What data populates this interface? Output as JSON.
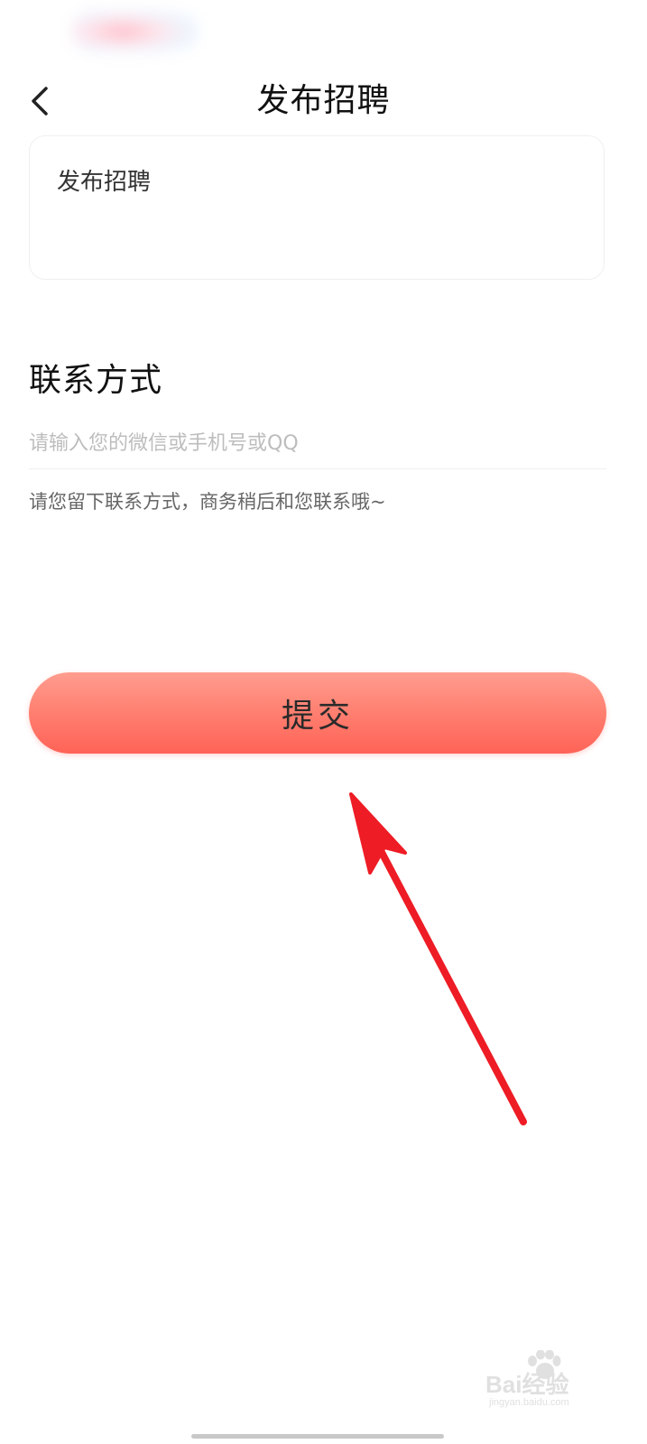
{
  "header": {
    "title": "发布招聘",
    "back_icon": "chevron-left-icon"
  },
  "description_card": {
    "text": "发布招聘"
  },
  "contact": {
    "section_title": "联系方式",
    "input_placeholder": "请输入您的微信或手机号或QQ",
    "input_value": "",
    "hint": "请您留下联系方式，商务稍后和您联系哦~"
  },
  "actions": {
    "submit_label": "提交"
  },
  "annotation": {
    "arrow_color": "#ee1c25"
  },
  "watermark": {
    "text": "Bai经验",
    "sub": "jingyan.baidu.com"
  },
  "colors": {
    "submit_gradient_top": "#ff9d8f",
    "submit_gradient_bottom": "#ff6357"
  }
}
